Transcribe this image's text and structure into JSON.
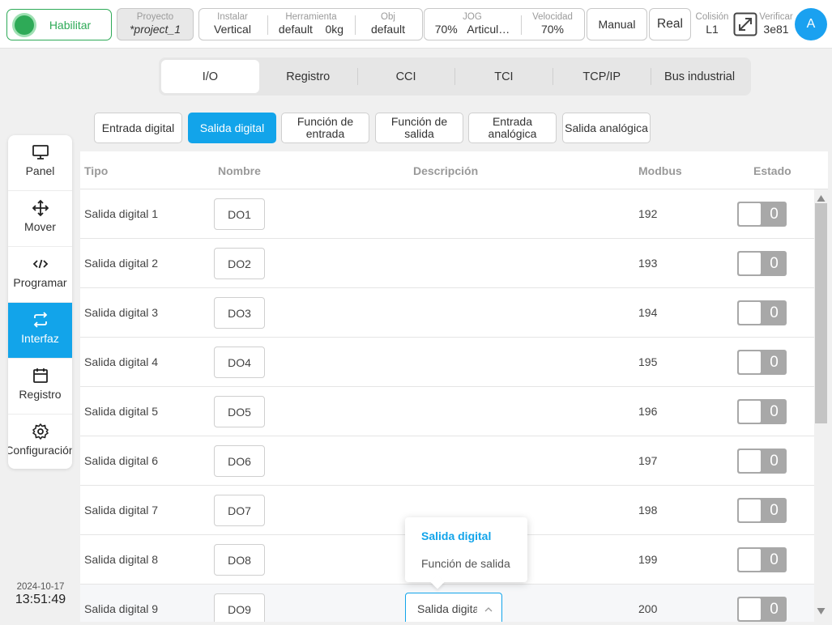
{
  "topbar": {
    "enable_label": "Habilitar",
    "project": {
      "caption": "Proyecto",
      "value": "*project_1"
    },
    "install": {
      "caption": "Instalar",
      "value": "Vertical"
    },
    "tool": {
      "caption": "Herramienta",
      "value": "default",
      "load": "0kg"
    },
    "obj": {
      "caption": "Obj",
      "value": "default"
    },
    "jog": {
      "caption": "JOG",
      "value": "70%",
      "mode": "Articul…"
    },
    "speed": {
      "caption": "Velocidad",
      "value": "70%"
    },
    "manual_label": "Manual",
    "real_label": "Real",
    "collision": {
      "caption": "Colisión",
      "value": "L1"
    },
    "verify": {
      "caption": "Verificar",
      "value": "3e81"
    },
    "avatar_letter": "A",
    "colors": {
      "enable": "#2eaa57",
      "accent": "#12a4ea"
    }
  },
  "sidebar": {
    "items": [
      {
        "label": "Panel",
        "icon": "monitor-icon"
      },
      {
        "label": "Mover",
        "icon": "move-arrows-icon"
      },
      {
        "label": "Programar",
        "icon": "code-icon"
      },
      {
        "label": "Interfaz",
        "icon": "swap-arrows-icon",
        "active": true
      },
      {
        "label": "Registro",
        "icon": "calendar-icon"
      },
      {
        "label": "Configuración",
        "icon": "gear-icon"
      }
    ]
  },
  "datetime": {
    "date": "2024-10-17",
    "time": "13:51:49"
  },
  "tabs": [
    "I/O",
    "Registro",
    "CCI",
    "TCI",
    "TCP/IP",
    "Bus industrial"
  ],
  "active_tab": "I/O",
  "subtabs": [
    "Entrada digital",
    "Salida digital",
    "Función de entrada",
    "Función de salida",
    "Entrada analógica",
    "Salida analógica"
  ],
  "active_subtab": "Salida digital",
  "table": {
    "headers": {
      "tipo": "Tipo",
      "nombre": "Nombre",
      "descripcion": "Descripción",
      "modbus": "Modbus",
      "estado": "Estado"
    },
    "rows": [
      {
        "tipo": "Salida digital 1",
        "nombre": "DO1",
        "modbus": "192",
        "estado": "0"
      },
      {
        "tipo": "Salida digital 2",
        "nombre": "DO2",
        "modbus": "193",
        "estado": "0"
      },
      {
        "tipo": "Salida digital 3",
        "nombre": "DO3",
        "modbus": "194",
        "estado": "0"
      },
      {
        "tipo": "Salida digital 4",
        "nombre": "DO4",
        "modbus": "195",
        "estado": "0"
      },
      {
        "tipo": "Salida digital 5",
        "nombre": "DO5",
        "modbus": "196",
        "estado": "0"
      },
      {
        "tipo": "Salida digital 6",
        "nombre": "DO6",
        "modbus": "197",
        "estado": "0"
      },
      {
        "tipo": "Salida digital 7",
        "nombre": "DO7",
        "modbus": "198",
        "estado": "0"
      },
      {
        "tipo": "Salida digital 8",
        "nombre": "DO8",
        "modbus": "199",
        "estado": "0"
      },
      {
        "tipo": "Salida digital 9",
        "nombre": "DO9",
        "modbus": "200",
        "estado": "0",
        "select_value": "Salida digital"
      }
    ]
  },
  "dropdown": {
    "options": [
      "Salida digital",
      "Función de salida"
    ],
    "selected": "Salida digital"
  }
}
